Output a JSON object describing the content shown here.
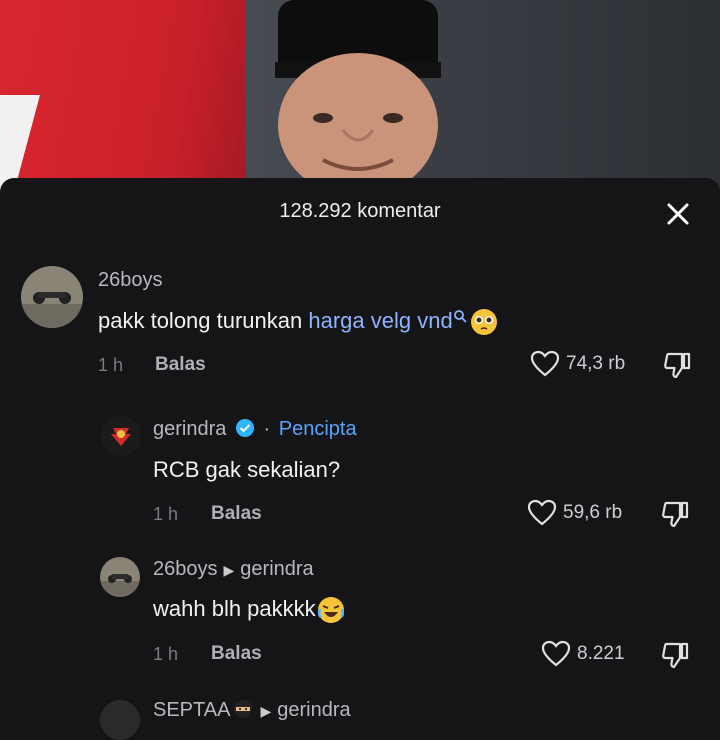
{
  "header": {
    "comment_count": "128.292 komentar"
  },
  "comments": [
    {
      "username": "26boys",
      "text_plain": "pakk tolong turunkan ",
      "text_link": "harga velg vnd",
      "time": "1 h",
      "reply": "Balas",
      "likes": "74,3 rb"
    },
    {
      "username": "gerindra",
      "separator": "·",
      "role": "Pencipta",
      "text": "RCB gak sekalian?",
      "time": "1 h",
      "reply": "Balas",
      "likes": "59,6 rb"
    },
    {
      "username": "26boys",
      "reply_to": "gerindra",
      "text": "wahh blh pakkkk",
      "time": "1 h",
      "reply": "Balas",
      "likes": "8.221"
    },
    {
      "username": "SEPTAA",
      "reply_to": "gerindra"
    }
  ],
  "colors": {
    "link": "#8fb3ff",
    "creator": "#57a4ff",
    "flag_red": "#d8262f",
    "background": "#151517"
  },
  "icons": [
    "close-icon",
    "heart-icon",
    "dislike-icon",
    "search-icon",
    "verified-badge-icon",
    "pleading-face-emoji",
    "laughing-emoji",
    "ninja-emoji",
    "triangle-right-icon"
  ]
}
